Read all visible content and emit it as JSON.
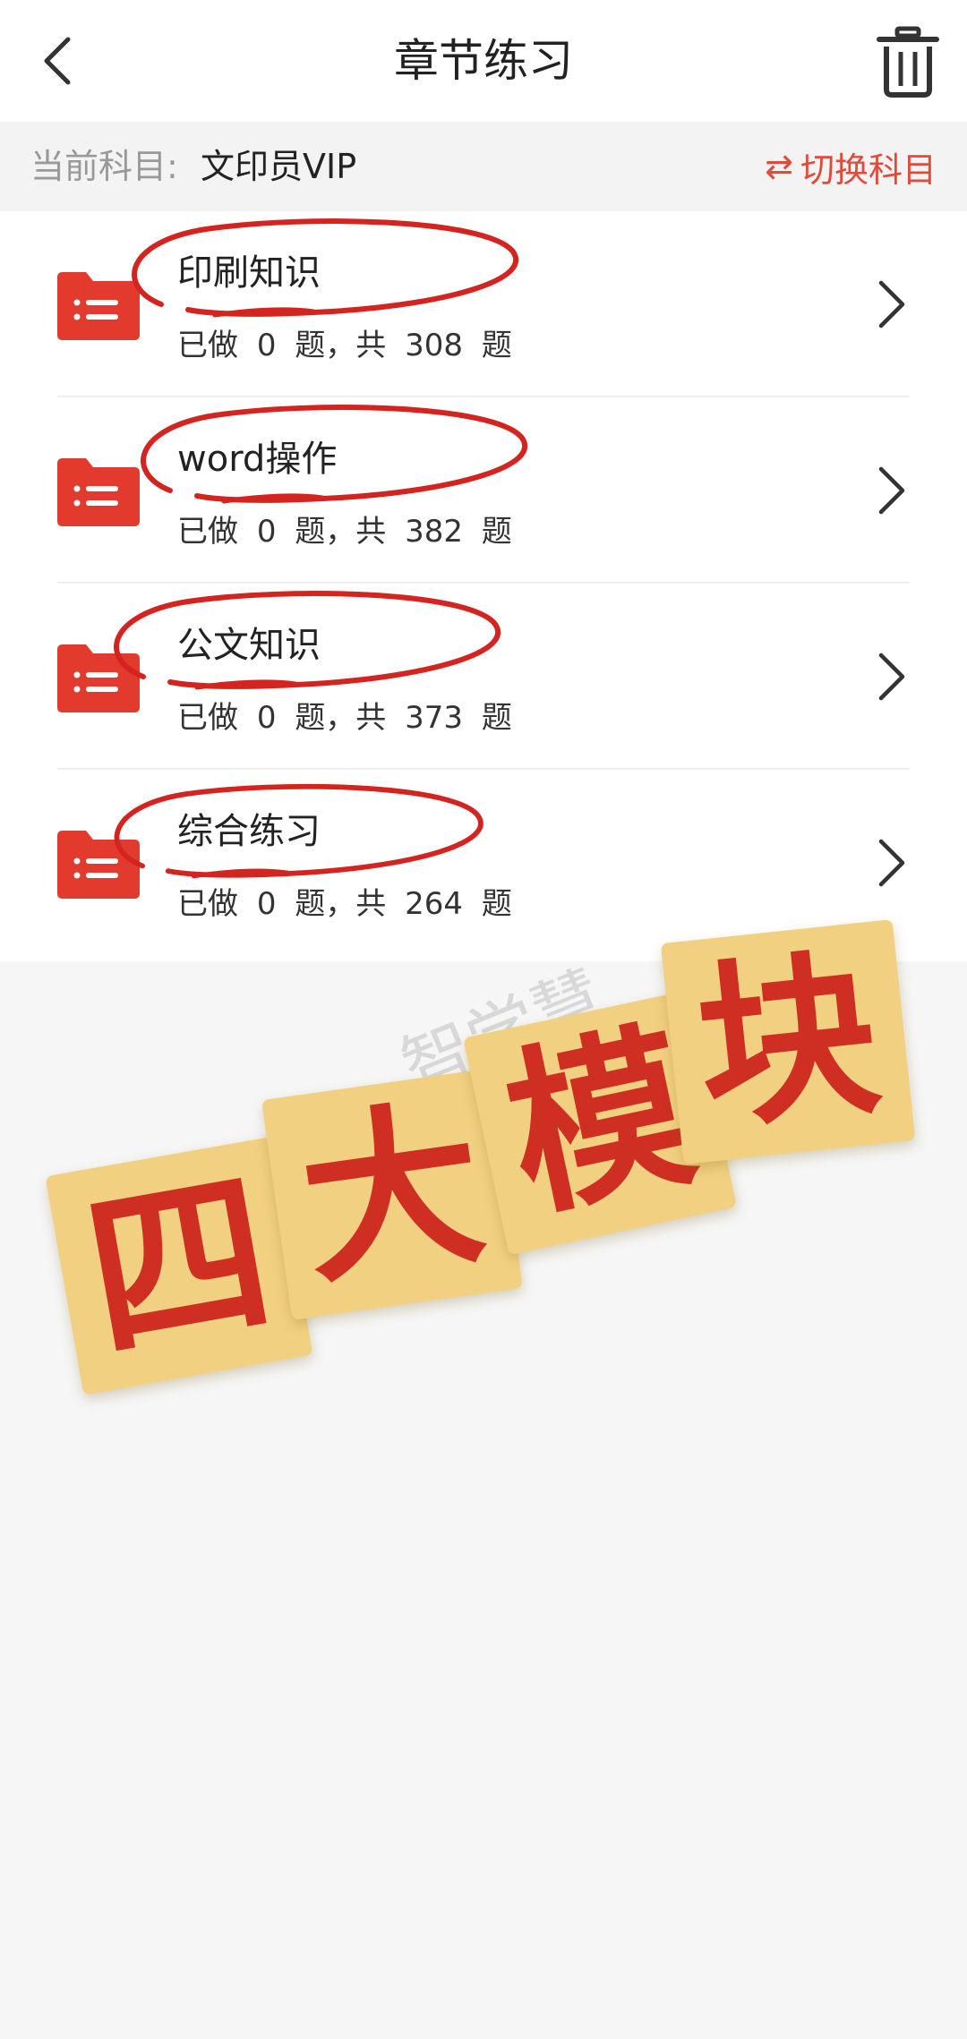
{
  "header": {
    "title": "章节练习",
    "back_icon": "chevron-left-icon",
    "trash_icon": "trash-icon"
  },
  "subject_bar": {
    "label": "当前科目:",
    "subject": "文印员VIP",
    "switch_label": "切换科目",
    "switch_icon": "swap-arrows-icon"
  },
  "chapters": [
    {
      "name": "印刷知识",
      "done_prefix": "已做",
      "done": "0",
      "done_suffix": "题，共",
      "total": "308",
      "total_suffix": "题"
    },
    {
      "name": "word操作",
      "done_prefix": "已做",
      "done": "0",
      "done_suffix": "题，共",
      "total": "382",
      "total_suffix": "题"
    },
    {
      "name": "公文知识",
      "done_prefix": "已做",
      "done": "0",
      "done_suffix": "题，共",
      "total": "373",
      "total_suffix": "题"
    },
    {
      "name": "综合练习",
      "done_prefix": "已做",
      "done": "0",
      "done_suffix": "题，共",
      "total": "264",
      "total_suffix": "题"
    }
  ],
  "sticker": {
    "chars": [
      "四",
      "大",
      "模",
      "块"
    ],
    "watermark": "智学慧"
  },
  "colors": {
    "accent": "#e24b3b",
    "folder": "#e33a2e",
    "tile": "#f1d181",
    "tile_text": "#cf2f22"
  }
}
